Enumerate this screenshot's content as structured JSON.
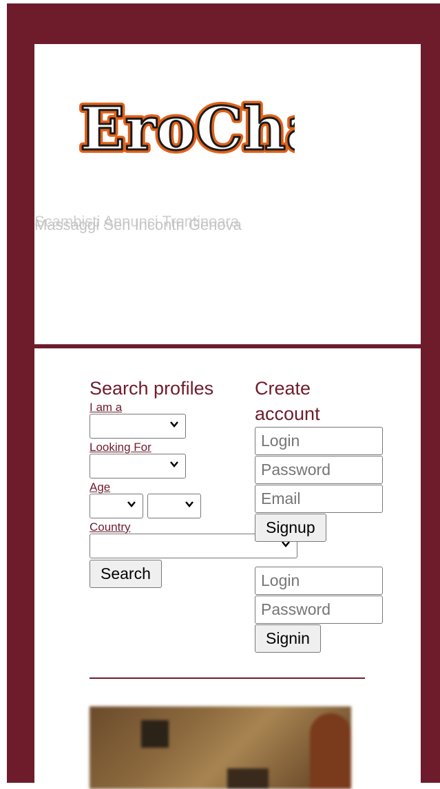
{
  "header": {
    "logo_text": "EroChat",
    "tagline_back": "Scambisti Annunci Trentinoara",
    "tagline_front": "Massaggi Sen Incontri Genova"
  },
  "search": {
    "title": "Search profiles",
    "iam_label": "I am a",
    "looking_label": "Looking For",
    "age_label": "Age",
    "country_label": "Country",
    "button": "Search"
  },
  "signup": {
    "title": "Create account",
    "login_placeholder": "Login",
    "password_placeholder": "Password",
    "email_placeholder": "Email",
    "button": "Signup"
  },
  "signin": {
    "login_placeholder": "Login",
    "password_placeholder": "Password",
    "button": "Signin"
  },
  "colors": {
    "brand": "#6e1c2c",
    "background": "#ffffff"
  }
}
